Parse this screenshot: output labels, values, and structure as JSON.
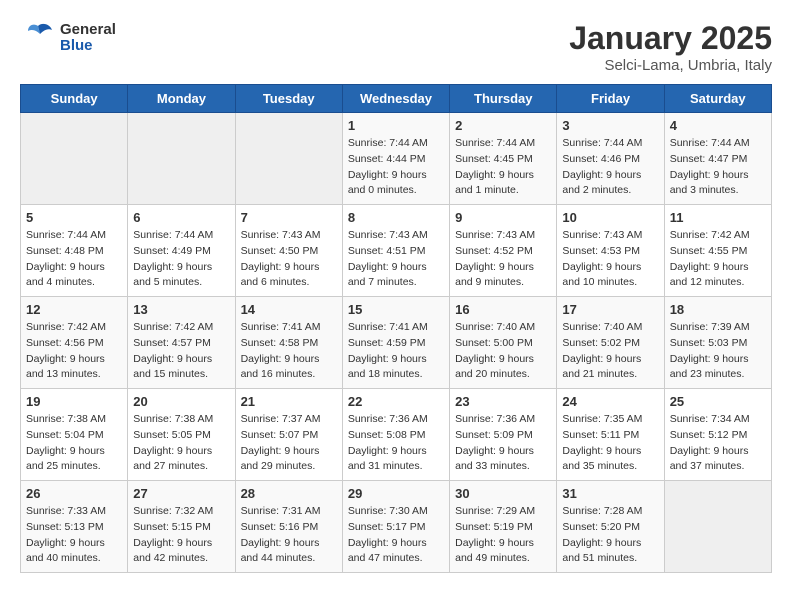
{
  "header": {
    "logo_general": "General",
    "logo_blue": "Blue",
    "month_title": "January 2025",
    "subtitle": "Selci-Lama, Umbria, Italy"
  },
  "days_of_week": [
    "Sunday",
    "Monday",
    "Tuesday",
    "Wednesday",
    "Thursday",
    "Friday",
    "Saturday"
  ],
  "weeks": [
    [
      {
        "day": "",
        "info": ""
      },
      {
        "day": "",
        "info": ""
      },
      {
        "day": "",
        "info": ""
      },
      {
        "day": "1",
        "info": "Sunrise: 7:44 AM\nSunset: 4:44 PM\nDaylight: 9 hours\nand 0 minutes."
      },
      {
        "day": "2",
        "info": "Sunrise: 7:44 AM\nSunset: 4:45 PM\nDaylight: 9 hours\nand 1 minute."
      },
      {
        "day": "3",
        "info": "Sunrise: 7:44 AM\nSunset: 4:46 PM\nDaylight: 9 hours\nand 2 minutes."
      },
      {
        "day": "4",
        "info": "Sunrise: 7:44 AM\nSunset: 4:47 PM\nDaylight: 9 hours\nand 3 minutes."
      }
    ],
    [
      {
        "day": "5",
        "info": "Sunrise: 7:44 AM\nSunset: 4:48 PM\nDaylight: 9 hours\nand 4 minutes."
      },
      {
        "day": "6",
        "info": "Sunrise: 7:44 AM\nSunset: 4:49 PM\nDaylight: 9 hours\nand 5 minutes."
      },
      {
        "day": "7",
        "info": "Sunrise: 7:43 AM\nSunset: 4:50 PM\nDaylight: 9 hours\nand 6 minutes."
      },
      {
        "day": "8",
        "info": "Sunrise: 7:43 AM\nSunset: 4:51 PM\nDaylight: 9 hours\nand 7 minutes."
      },
      {
        "day": "9",
        "info": "Sunrise: 7:43 AM\nSunset: 4:52 PM\nDaylight: 9 hours\nand 9 minutes."
      },
      {
        "day": "10",
        "info": "Sunrise: 7:43 AM\nSunset: 4:53 PM\nDaylight: 9 hours\nand 10 minutes."
      },
      {
        "day": "11",
        "info": "Sunrise: 7:42 AM\nSunset: 4:55 PM\nDaylight: 9 hours\nand 12 minutes."
      }
    ],
    [
      {
        "day": "12",
        "info": "Sunrise: 7:42 AM\nSunset: 4:56 PM\nDaylight: 9 hours\nand 13 minutes."
      },
      {
        "day": "13",
        "info": "Sunrise: 7:42 AM\nSunset: 4:57 PM\nDaylight: 9 hours\nand 15 minutes."
      },
      {
        "day": "14",
        "info": "Sunrise: 7:41 AM\nSunset: 4:58 PM\nDaylight: 9 hours\nand 16 minutes."
      },
      {
        "day": "15",
        "info": "Sunrise: 7:41 AM\nSunset: 4:59 PM\nDaylight: 9 hours\nand 18 minutes."
      },
      {
        "day": "16",
        "info": "Sunrise: 7:40 AM\nSunset: 5:00 PM\nDaylight: 9 hours\nand 20 minutes."
      },
      {
        "day": "17",
        "info": "Sunrise: 7:40 AM\nSunset: 5:02 PM\nDaylight: 9 hours\nand 21 minutes."
      },
      {
        "day": "18",
        "info": "Sunrise: 7:39 AM\nSunset: 5:03 PM\nDaylight: 9 hours\nand 23 minutes."
      }
    ],
    [
      {
        "day": "19",
        "info": "Sunrise: 7:38 AM\nSunset: 5:04 PM\nDaylight: 9 hours\nand 25 minutes."
      },
      {
        "day": "20",
        "info": "Sunrise: 7:38 AM\nSunset: 5:05 PM\nDaylight: 9 hours\nand 27 minutes."
      },
      {
        "day": "21",
        "info": "Sunrise: 7:37 AM\nSunset: 5:07 PM\nDaylight: 9 hours\nand 29 minutes."
      },
      {
        "day": "22",
        "info": "Sunrise: 7:36 AM\nSunset: 5:08 PM\nDaylight: 9 hours\nand 31 minutes."
      },
      {
        "day": "23",
        "info": "Sunrise: 7:36 AM\nSunset: 5:09 PM\nDaylight: 9 hours\nand 33 minutes."
      },
      {
        "day": "24",
        "info": "Sunrise: 7:35 AM\nSunset: 5:11 PM\nDaylight: 9 hours\nand 35 minutes."
      },
      {
        "day": "25",
        "info": "Sunrise: 7:34 AM\nSunset: 5:12 PM\nDaylight: 9 hours\nand 37 minutes."
      }
    ],
    [
      {
        "day": "26",
        "info": "Sunrise: 7:33 AM\nSunset: 5:13 PM\nDaylight: 9 hours\nand 40 minutes."
      },
      {
        "day": "27",
        "info": "Sunrise: 7:32 AM\nSunset: 5:15 PM\nDaylight: 9 hours\nand 42 minutes."
      },
      {
        "day": "28",
        "info": "Sunrise: 7:31 AM\nSunset: 5:16 PM\nDaylight: 9 hours\nand 44 minutes."
      },
      {
        "day": "29",
        "info": "Sunrise: 7:30 AM\nSunset: 5:17 PM\nDaylight: 9 hours\nand 47 minutes."
      },
      {
        "day": "30",
        "info": "Sunrise: 7:29 AM\nSunset: 5:19 PM\nDaylight: 9 hours\nand 49 minutes."
      },
      {
        "day": "31",
        "info": "Sunrise: 7:28 AM\nSunset: 5:20 PM\nDaylight: 9 hours\nand 51 minutes."
      },
      {
        "day": "",
        "info": ""
      }
    ]
  ]
}
